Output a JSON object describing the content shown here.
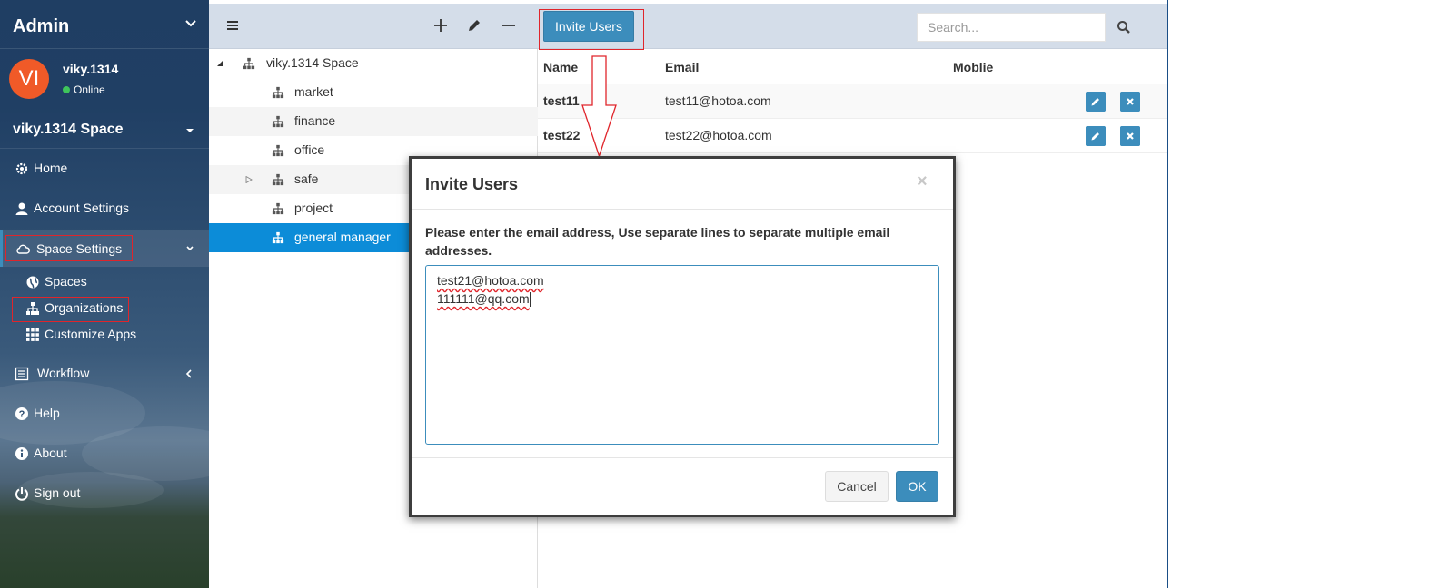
{
  "sidebar": {
    "title": "Admin",
    "user": {
      "initials": "VI",
      "name": "viky.1314",
      "status": "Online"
    },
    "space_selector": "viky.1314 Space",
    "items": [
      {
        "label": "Home",
        "icon": "gear-icon"
      },
      {
        "label": "Account Settings",
        "icon": "user-icon"
      },
      {
        "label": "Space Settings",
        "icon": "cloud-icon"
      },
      {
        "label": "Workflow",
        "icon": "list-icon"
      },
      {
        "label": "Help",
        "icon": "question-icon"
      },
      {
        "label": "About",
        "icon": "info-icon"
      },
      {
        "label": "Sign out",
        "icon": "power-icon"
      }
    ],
    "sub_items": [
      {
        "label": "Spaces",
        "icon": "globe-icon"
      },
      {
        "label": "Organizations",
        "icon": "sitemap-icon"
      },
      {
        "label": "Customize Apps",
        "icon": "grid-icon"
      }
    ]
  },
  "tree": {
    "root": "viky.1314 Space",
    "nodes": [
      "market",
      "finance",
      "office",
      "safe",
      "project",
      "general manager"
    ]
  },
  "users": {
    "invite_label": "Invite Users",
    "search_placeholder": "Search...",
    "columns": [
      "Name",
      "Email",
      "Moblie"
    ],
    "rows": [
      {
        "name": "test11",
        "email": "test11@hotoa.com",
        "mobile": ""
      },
      {
        "name": "test22",
        "email": "test22@hotoa.com",
        "mobile": ""
      }
    ]
  },
  "modal": {
    "title": "Invite Users",
    "close": "×",
    "label": "Please enter the email address, Use separate lines to separate multiple email addresses.",
    "emails": [
      "test21@hotoa.com",
      "111111@qq.com"
    ],
    "cancel": "Cancel",
    "ok": "OK"
  },
  "colors": {
    "accent": "#3c8dbc",
    "selected": "#0c8cd8",
    "avatar": "#f05a28",
    "highlight": "#e0252b"
  }
}
